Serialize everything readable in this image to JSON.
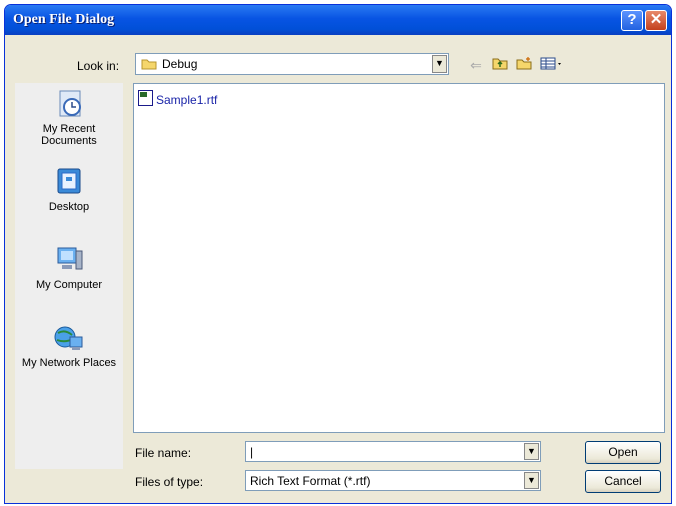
{
  "window": {
    "title": "Open File Dialog",
    "help_label": "?",
    "close_label": "✕"
  },
  "look_in": {
    "label": "Look in:",
    "value": "Debug"
  },
  "places": [
    {
      "label": "My Recent Documents",
      "icon": "recent-documents-icon"
    },
    {
      "label": "Desktop",
      "icon": "desktop-icon"
    },
    {
      "label": "My Computer",
      "icon": "my-computer-icon"
    },
    {
      "label": "My Network Places",
      "icon": "network-places-icon"
    }
  ],
  "files": [
    {
      "name": "Sample1.rtf"
    }
  ],
  "file_name": {
    "label": "File name:",
    "value": "|"
  },
  "file_type": {
    "label": "Files of type:",
    "value": "Rich Text Format (*.rtf)"
  },
  "buttons": {
    "open": "Open",
    "cancel": "Cancel"
  }
}
